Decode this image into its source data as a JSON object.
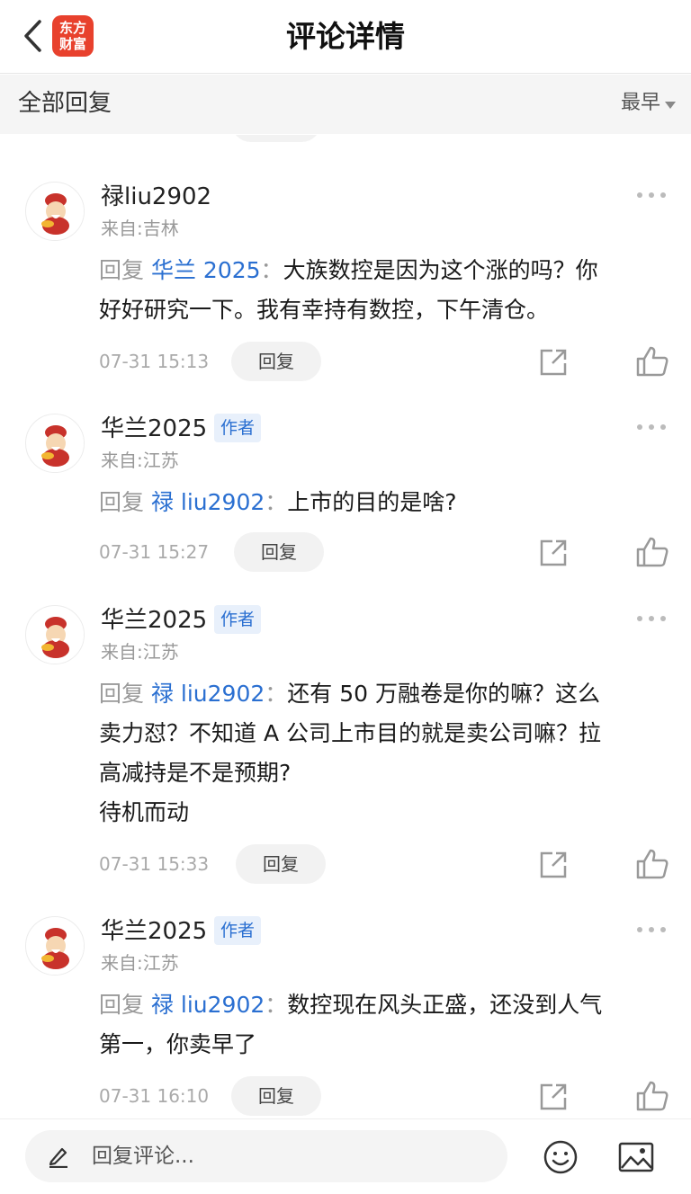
{
  "header": {
    "title": "评论详情",
    "logo_line1": "东方",
    "logo_line2": "财富"
  },
  "subheader": {
    "all_replies": "全部回复",
    "sort": "最早"
  },
  "colors": {
    "brand": "#e8412d",
    "link": "#2a6fd1",
    "muted": "#999999"
  },
  "comments": [
    {
      "user": "禄liu2902",
      "is_author": false,
      "location": "来自:吉林",
      "reply_prefix": "回复",
      "reply_to": "华兰 2025",
      "separator": "：",
      "lines": [
        "大族数控是因为这个涨的吗？你",
        "好好研究一下。我有幸持有数控，下午清仓。"
      ],
      "time": "07-31 15:13",
      "reply_label": "回复"
    },
    {
      "user": "华兰2025",
      "is_author": true,
      "author_badge": "作者",
      "location": "来自:江苏",
      "reply_prefix": "回复",
      "reply_to": "禄 liu2902",
      "separator": "：",
      "lines": [
        "上市的目的是啥?"
      ],
      "time": "07-31 15:27",
      "reply_label": "回复"
    },
    {
      "user": "华兰2025",
      "is_author": true,
      "author_badge": "作者",
      "location": "来自:江苏",
      "reply_prefix": "回复",
      "reply_to": "禄 liu2902",
      "separator": "：",
      "lines": [
        "还有 50 万融卷是你的嘛？这么",
        "卖力怼？不知道 A 公司上市目的就是卖公司嘛？拉",
        "高减持是不是预期?",
        "待机而动"
      ],
      "time": "07-31 15:33",
      "reply_label": "回复"
    },
    {
      "user": "华兰2025",
      "is_author": true,
      "author_badge": "作者",
      "location": "来自:江苏",
      "reply_prefix": "回复",
      "reply_to": "禄 liu2902",
      "separator": "：",
      "lines": [
        "数控现在风头正盛，还没到人气",
        "第一，你卖早了"
      ],
      "time": "07-31 16:10",
      "reply_label": "回复"
    }
  ],
  "bottom": {
    "placeholder": "回复评论..."
  },
  "icons": {
    "back": "chevron-left-icon",
    "share": "share-icon",
    "like": "thumbs-up-icon",
    "more": "more-dots-icon",
    "pen": "pen-icon",
    "emoji": "emoji-icon",
    "image": "image-icon"
  }
}
